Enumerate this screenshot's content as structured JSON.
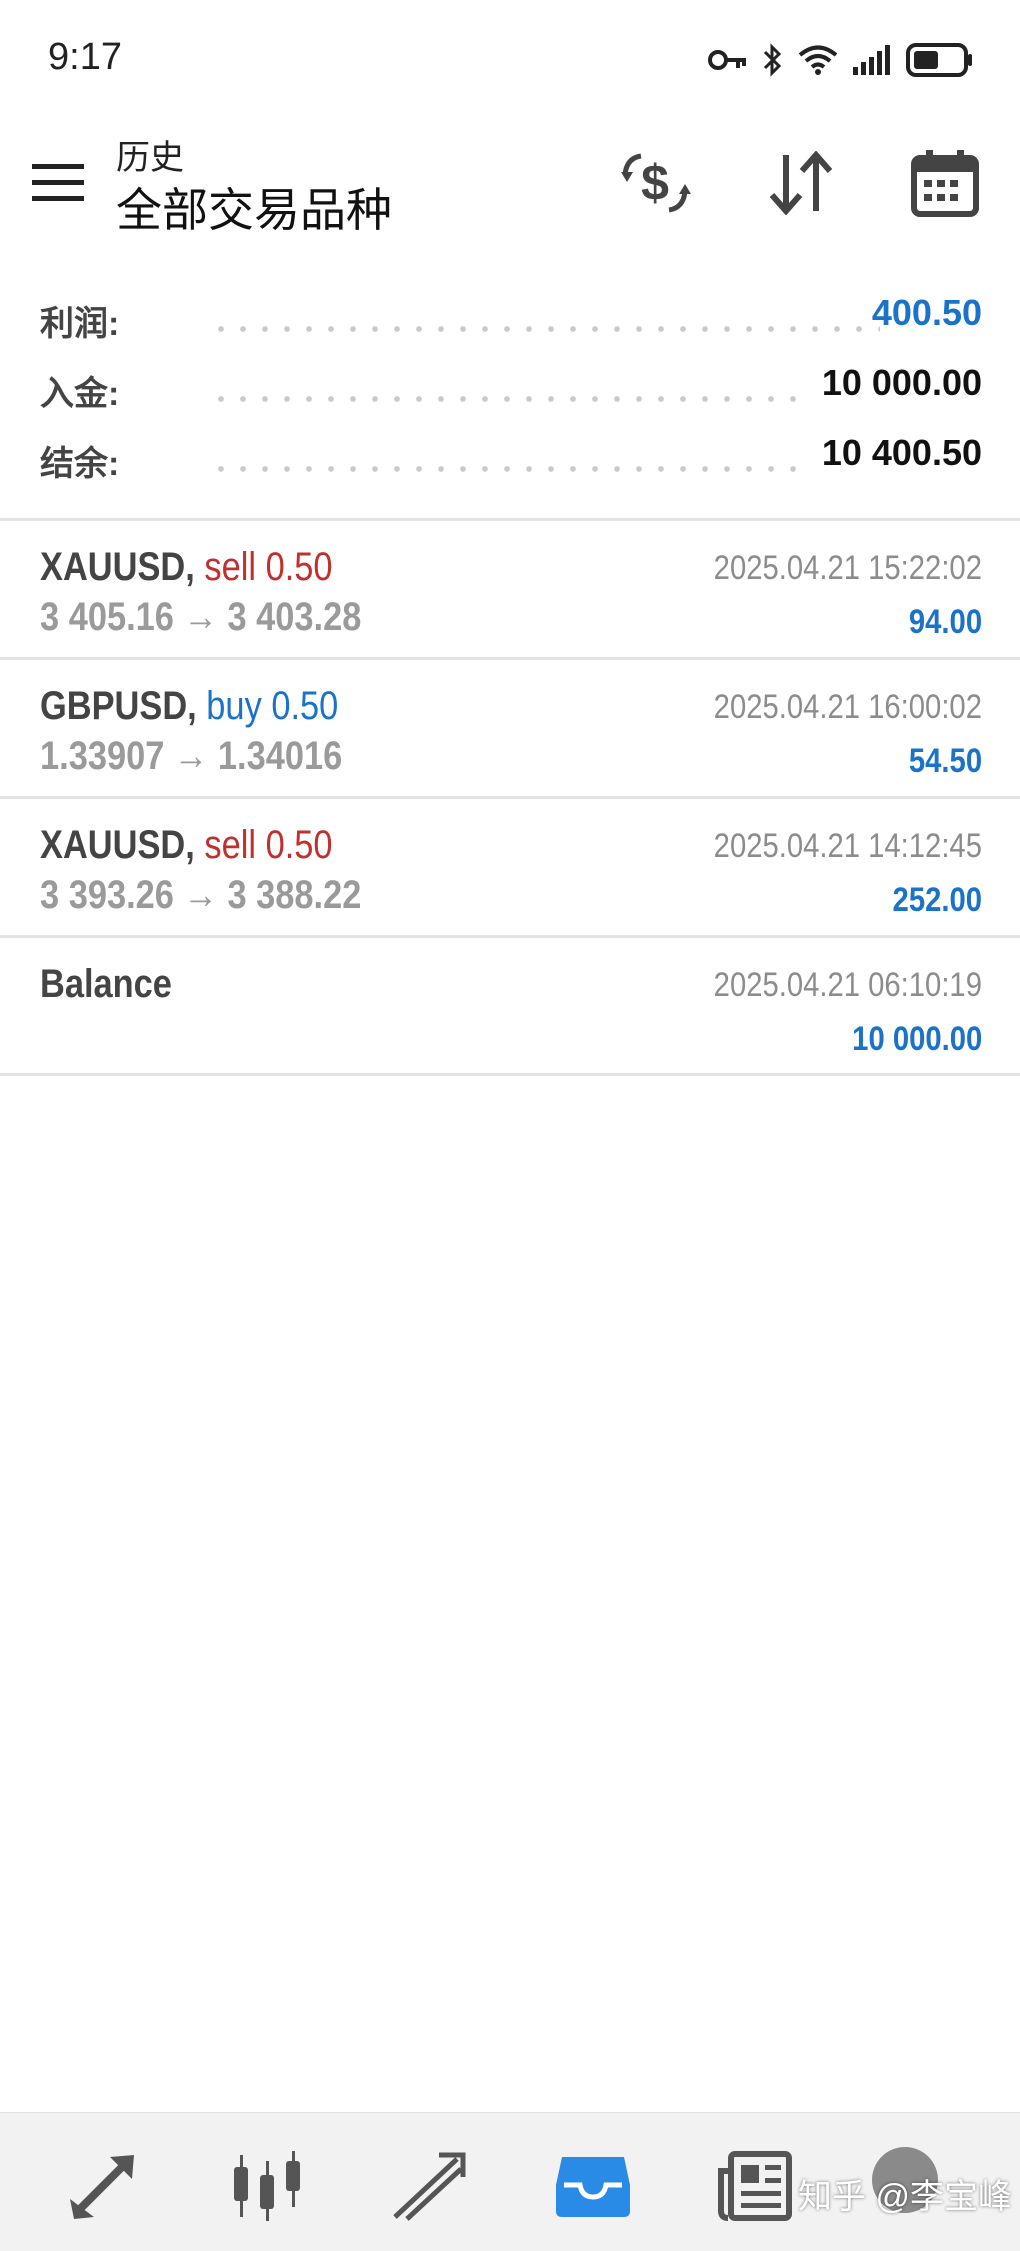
{
  "status_bar": {
    "time": "9:17"
  },
  "header": {
    "subtitle": "历史",
    "title": "全部交易品种"
  },
  "toolbar": {
    "icons": [
      "currency-exchange-icon",
      "sort-icon",
      "calendar-icon"
    ]
  },
  "summary": {
    "profit_label": "利润:",
    "profit_value": "400.50",
    "deposit_label": "入金:",
    "deposit_value": "10 000.00",
    "balance_label": "结余:",
    "balance_value": "10 400.50"
  },
  "deals": [
    {
      "symbol": "XAUUSD,",
      "side": "sell 0.50",
      "open_price": "3 405.16",
      "arrow": "→",
      "close_price": "3 403.28",
      "time": "2025.04.21 15:22:02",
      "profit": "94.00"
    },
    {
      "symbol": "GBPUSD,",
      "side": "buy 0.50",
      "open_price": "1.33907",
      "arrow": "→",
      "close_price": "1.34016",
      "time": "2025.04.21 16:00:02",
      "profit": "54.50"
    },
    {
      "symbol": "XAUUSD,",
      "side": "sell 0.50",
      "open_price": "3 393.26",
      "arrow": "→",
      "close_price": "3 388.22",
      "time": "2025.04.21 14:12:45",
      "profit": "252.00"
    },
    {
      "symbol": "Balance",
      "time": "2025.04.21 06:10:19",
      "profit": "10 000.00"
    }
  ],
  "bottom_nav": {
    "items": [
      "quotes-icon",
      "chart-icon",
      "trade-icon",
      "history-icon",
      "news-icon",
      "settings-icon"
    ],
    "active": "history-icon"
  },
  "watermark": "知乎 @李宝峰",
  "colors": {
    "accent": "#1a73c8",
    "sell": "#c0302d",
    "active_tab": "#2a8be6"
  }
}
